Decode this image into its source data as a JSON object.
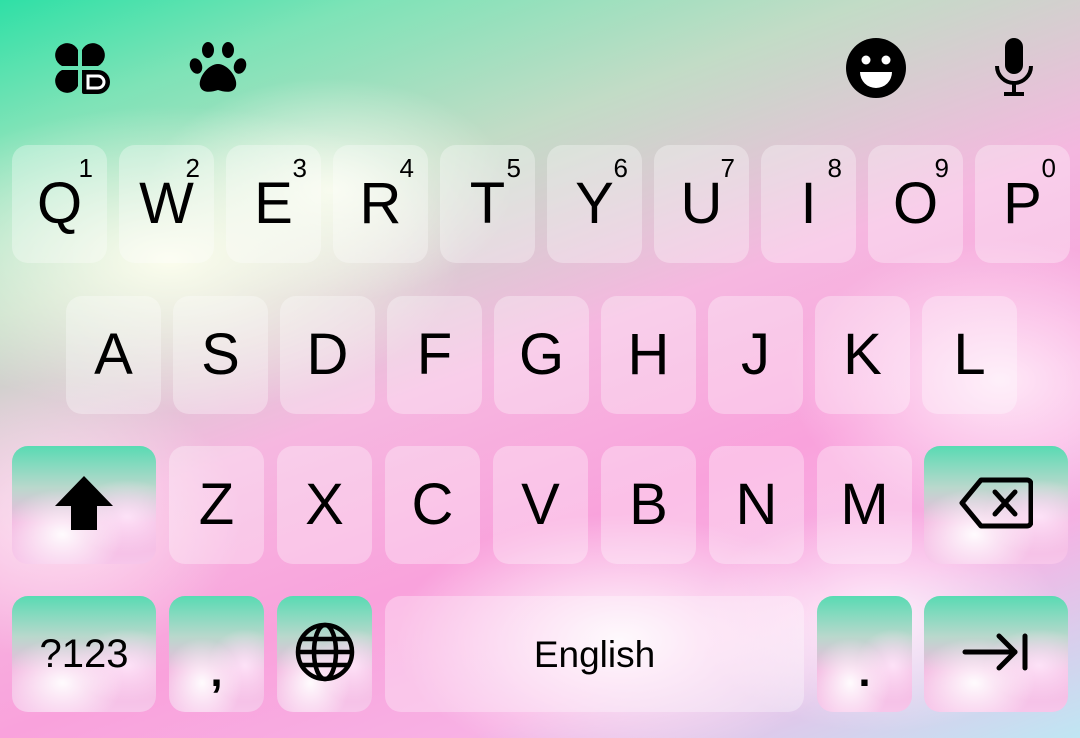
{
  "toolbar": {
    "icons": [
      "clover-heart-icon",
      "paw-icon",
      "emoji-smile-icon",
      "microphone-icon"
    ]
  },
  "rows": {
    "row1": [
      {
        "label": "Q",
        "hint": "1"
      },
      {
        "label": "W",
        "hint": "2"
      },
      {
        "label": "E",
        "hint": "3"
      },
      {
        "label": "R",
        "hint": "4"
      },
      {
        "label": "T",
        "hint": "5"
      },
      {
        "label": "Y",
        "hint": "6"
      },
      {
        "label": "U",
        "hint": "7"
      },
      {
        "label": "I",
        "hint": "8"
      },
      {
        "label": "O",
        "hint": "9"
      },
      {
        "label": "P",
        "hint": "0"
      }
    ],
    "row2": [
      "A",
      "S",
      "D",
      "F",
      "G",
      "H",
      "J",
      "K",
      "L"
    ],
    "row3": [
      "Z",
      "X",
      "C",
      "V",
      "B",
      "N",
      "M"
    ],
    "row4": {
      "symbols": "?123",
      "comma": ",",
      "space": "English",
      "period": "."
    }
  },
  "icons": {
    "shift": "shift-arrow-icon",
    "backspace": "backspace-icon",
    "globe": "globe-icon",
    "enter": "tab-arrow-icon"
  },
  "colors": {
    "key_text": "#000000",
    "key_bg": "rgba(255,255,255,0.32)"
  }
}
